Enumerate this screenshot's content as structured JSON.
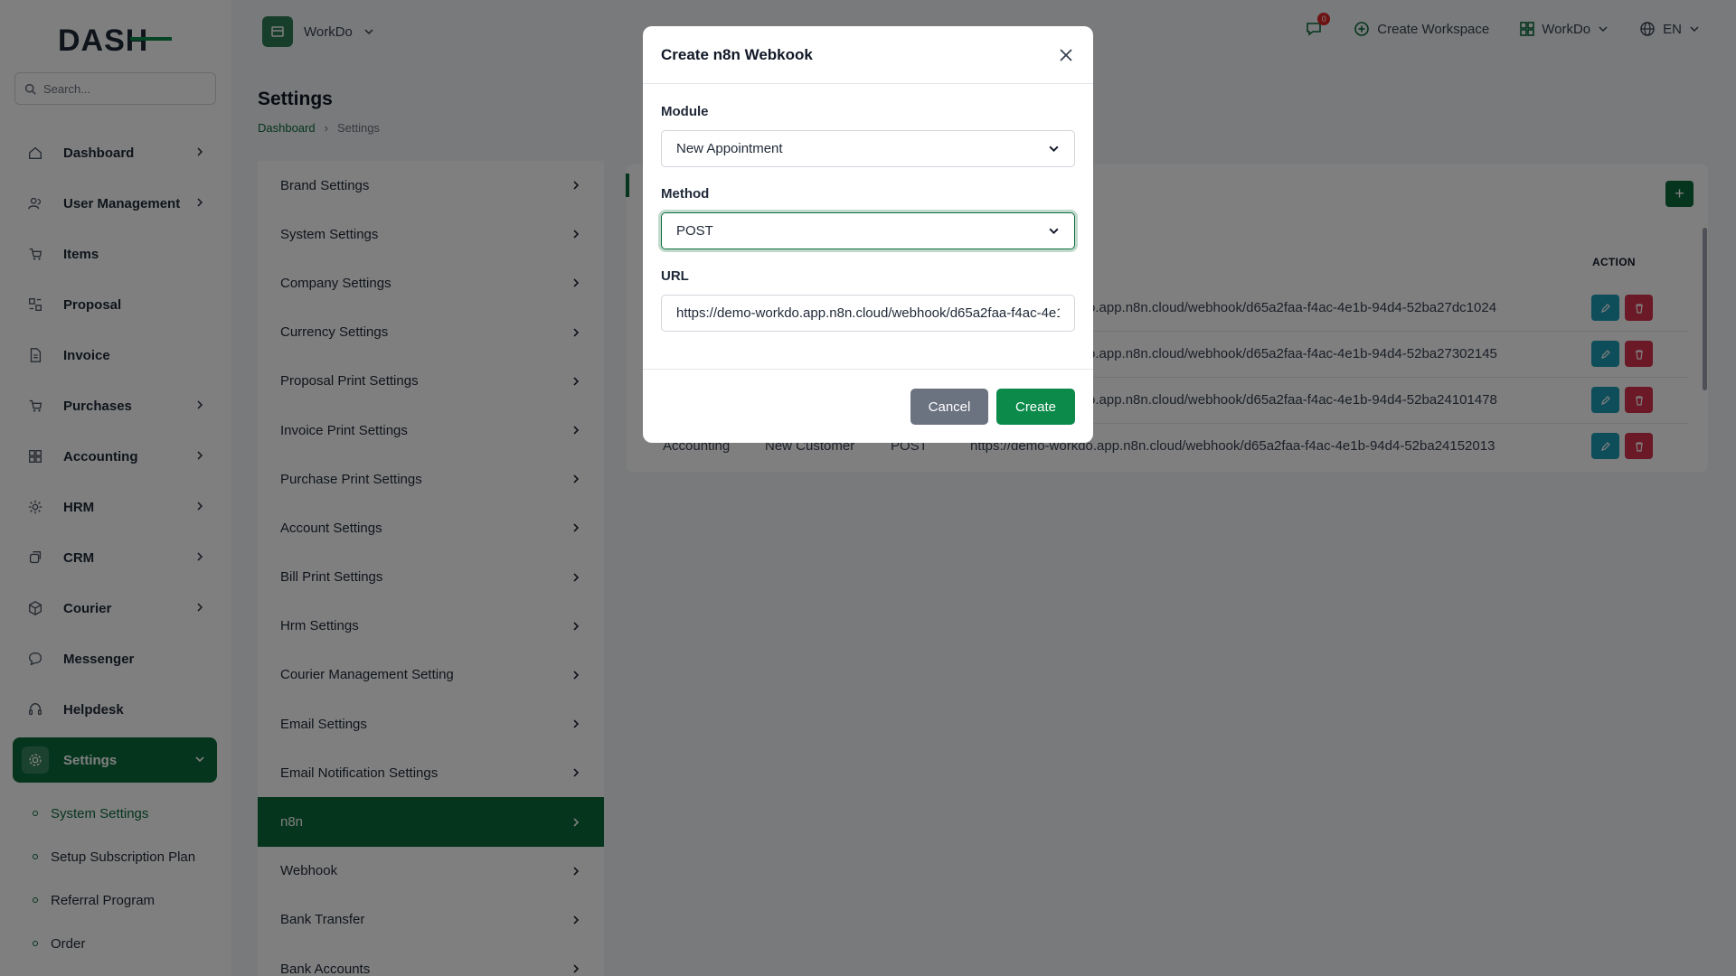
{
  "brand": {
    "logo_text": "DASH"
  },
  "search": {
    "placeholder": "Search..."
  },
  "sidebar": {
    "items": [
      {
        "label": "Dashboard",
        "icon": "home-icon",
        "has_chevron": true
      },
      {
        "label": "User Management",
        "icon": "users-icon",
        "has_chevron": true
      },
      {
        "label": "Items",
        "icon": "cart-icon",
        "has_chevron": false
      },
      {
        "label": "Proposal",
        "icon": "proposal-icon",
        "has_chevron": false
      },
      {
        "label": "Invoice",
        "icon": "invoice-icon",
        "has_chevron": false
      },
      {
        "label": "Purchases",
        "icon": "cart-icon",
        "has_chevron": true
      },
      {
        "label": "Accounting",
        "icon": "grid-icon",
        "has_chevron": true
      },
      {
        "label": "HRM",
        "icon": "hrm-icon",
        "has_chevron": true
      },
      {
        "label": "CRM",
        "icon": "crm-icon",
        "has_chevron": true
      },
      {
        "label": "Courier",
        "icon": "box-icon",
        "has_chevron": true
      },
      {
        "label": "Messenger",
        "icon": "chat-icon",
        "has_chevron": false
      },
      {
        "label": "Helpdesk",
        "icon": "headset-icon",
        "has_chevron": false
      },
      {
        "label": "Settings",
        "icon": "gear-icon",
        "has_chevron": true,
        "active": true
      }
    ],
    "sub_items": [
      {
        "label": "System Settings",
        "active": true
      },
      {
        "label": "Setup Subscription Plan"
      },
      {
        "label": "Referral Program"
      },
      {
        "label": "Order"
      }
    ]
  },
  "header": {
    "workspace": "WorkDo",
    "notification_count": "0",
    "create_workspace": "Create Workspace",
    "workspace_menu": "WorkDo",
    "language": "EN"
  },
  "page": {
    "title": "Settings",
    "breadcrumb": [
      "Dashboard",
      "Settings"
    ]
  },
  "settings_menu": [
    "Brand Settings",
    "System Settings",
    "Company Settings",
    "Currency Settings",
    "Proposal Print Settings",
    "Invoice Print Settings",
    "Purchase Print Settings",
    "Account Settings",
    "Bill Print Settings",
    "Hrm Settings",
    "Courier Management Setting",
    "Email Settings",
    "Email Notification Settings",
    "n8n",
    "Webhook",
    "Bank Transfer",
    "Bank Accounts"
  ],
  "settings_active": "n8n",
  "table": {
    "action_header": "ACTION",
    "rows": [
      {
        "module": "",
        "event": "",
        "method": "",
        "url": "o.app.n8n.cloud/webhook/d65a2faa-f4ac-4e1b-94d4-52ba27dc1024"
      },
      {
        "module": "",
        "event": "",
        "method": "",
        "url": "o.app.n8n.cloud/webhook/d65a2faa-f4ac-4e1b-94d4-52ba27302145"
      },
      {
        "module": "",
        "event": "",
        "method": "",
        "url": "o.app.n8n.cloud/webhook/d65a2faa-f4ac-4e1b-94d4-52ba24101478"
      },
      {
        "module": "Accounting",
        "event": "New Customer",
        "method": "POST",
        "url": "https://demo-workdo.app.n8n.cloud/webhook/d65a2faa-f4ac-4e1b-94d4-52ba24152013"
      }
    ]
  },
  "modal": {
    "title": "Create n8n Webkook",
    "module_label": "Module",
    "module_value": "New Appointment",
    "method_label": "Method",
    "method_value": "POST",
    "url_label": "URL",
    "url_value": "https://demo-workdo.app.n8n.cloud/webhook/d65a2faa-f4ac-4e1",
    "cancel_label": "Cancel",
    "create_label": "Create"
  },
  "colors": {
    "primary": "#0b6b3a",
    "edit": "#1d9cb5",
    "delete": "#d6334e"
  }
}
